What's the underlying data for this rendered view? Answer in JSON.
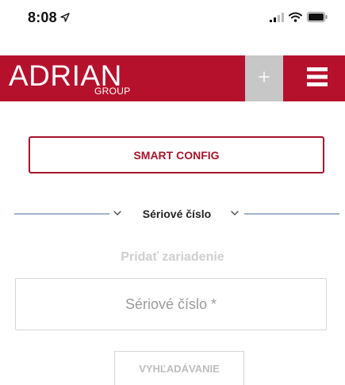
{
  "status_bar": {
    "time": "8:08",
    "icons": [
      "location-arrow-icon",
      "signal-icon",
      "wifi-icon",
      "battery-icon"
    ]
  },
  "header": {
    "brand_main": "ADRIAN",
    "brand_sub": "GROUP",
    "add_symbol": "+",
    "background_color": "#b5112c"
  },
  "smart_config": {
    "label": "SMART CONFIG"
  },
  "section_selector": {
    "label": "Sériové číslo"
  },
  "form": {
    "title": "Pridať zariadenie",
    "serial_placeholder": "Sériové číslo *",
    "serial_value": "",
    "search_label": "VYHĽADÁVANIE"
  },
  "colors": {
    "accent": "#a5142c",
    "divider": "#9fb3c8",
    "muted": "#cfcfcf"
  }
}
